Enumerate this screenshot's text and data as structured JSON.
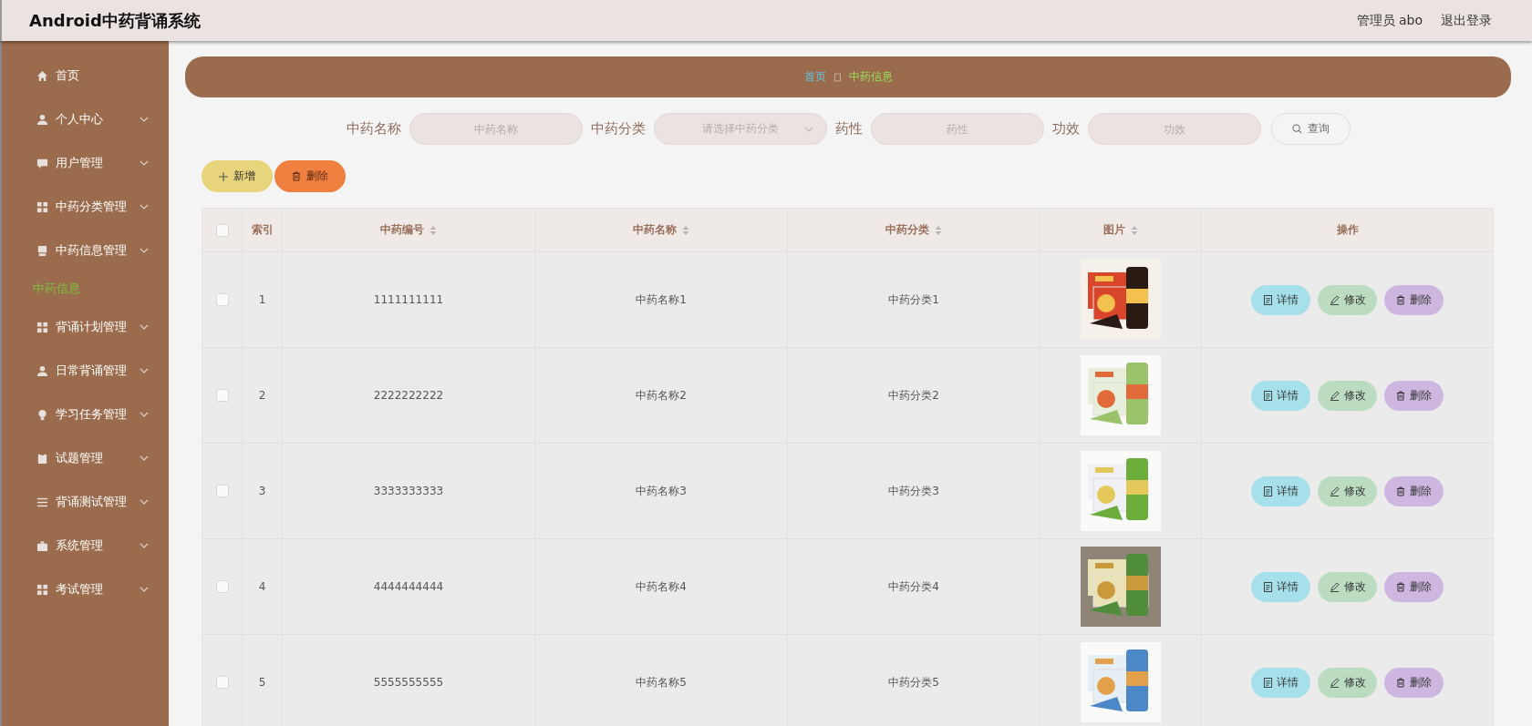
{
  "header": {
    "title": "Android中药背诵系统",
    "user": "管理员 abo",
    "logout": "退出登录"
  },
  "sidebar": {
    "items": [
      {
        "label": "首页",
        "submenu": false
      },
      {
        "label": "个人中心",
        "submenu": true
      },
      {
        "label": "用户管理",
        "submenu": true
      },
      {
        "label": "中药分类管理",
        "submenu": true
      },
      {
        "label": "中药信息管理",
        "submenu": true,
        "children": [
          {
            "label": "中药信息",
            "selected": true
          }
        ]
      },
      {
        "label": "背诵计划管理",
        "submenu": true
      },
      {
        "label": "日常背诵管理",
        "submenu": true
      },
      {
        "label": "学习任务管理",
        "submenu": true
      },
      {
        "label": "试题管理",
        "submenu": true
      },
      {
        "label": "背诵测试管理",
        "submenu": true
      },
      {
        "label": "系统管理",
        "submenu": true
      },
      {
        "label": "考试管理",
        "submenu": true
      }
    ]
  },
  "breadcrumb": [
    "首页",
    "中药信息"
  ],
  "search": {
    "fields": [
      {
        "label": "中药名称",
        "placeholder": "中药名称",
        "kind": "input"
      },
      {
        "label": "中药分类",
        "placeholder": "请选择中药分类",
        "kind": "select"
      },
      {
        "label": "药性",
        "placeholder": "药性",
        "kind": "input"
      },
      {
        "label": "功效",
        "placeholder": "功效",
        "kind": "input"
      }
    ],
    "button": "查询"
  },
  "actions": {
    "add": "新增",
    "delete": "删除"
  },
  "table": {
    "all_checked": false,
    "columns": [
      {
        "label": "索引",
        "sortable": false
      },
      {
        "label": "中药编号",
        "sortable": true
      },
      {
        "label": "中药名称",
        "sortable": true
      },
      {
        "label": "中药分类",
        "sortable": true
      },
      {
        "label": "图片",
        "sortable": true
      },
      {
        "label": "操作",
        "sortable": false
      }
    ],
    "rows": [
      {
        "checked": false,
        "index": "1",
        "code": "1111111111",
        "name": "中药名称1",
        "category": "中药分类1",
        "image": {
          "kind": "picture"
        },
        "buttons": [
          "详情",
          "修改",
          "删除"
        ]
      },
      {
        "checked": false,
        "index": "2",
        "code": "2222222222",
        "name": "中药名称2",
        "category": "中药分类2",
        "image": {
          "kind": "picture"
        },
        "buttons": [
          "详情",
          "修改",
          "删除"
        ]
      },
      {
        "checked": false,
        "index": "3",
        "code": "3333333333",
        "name": "中药名称3",
        "category": "中药分类3",
        "image": {
          "kind": "picture"
        },
        "buttons": [
          "详情",
          "修改",
          "删除"
        ]
      },
      {
        "checked": false,
        "index": "4",
        "code": "4444444444",
        "name": "中药名称4",
        "category": "中药分类4",
        "image": {
          "kind": "picture"
        },
        "buttons": [
          "详情",
          "修改",
          "删除"
        ]
      },
      {
        "checked": false,
        "index": "5",
        "code": "5555555555",
        "name": "中药名称5",
        "category": "中药分类5",
        "image": {
          "kind": "picture"
        },
        "buttons": [
          "详情",
          "修改",
          "删除"
        ]
      }
    ]
  }
}
